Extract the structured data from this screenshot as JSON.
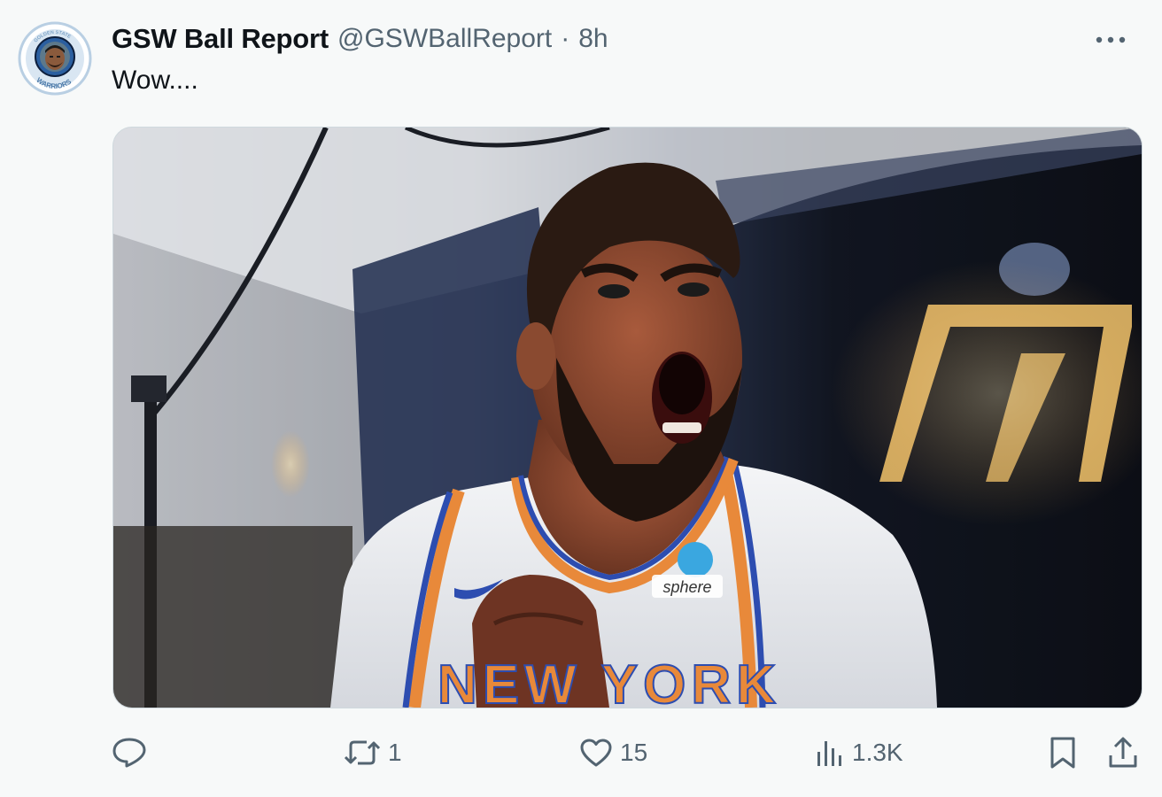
{
  "tweet": {
    "display_name": "GSW Ball Report",
    "handle": "@GSWBallReport",
    "separator": "·",
    "time": "8h",
    "text": "Wow....",
    "avatar": {
      "badge_text_top": "GOLDEN STATE",
      "badge_text_bottom": "WARRIORS"
    },
    "media": {
      "jersey_sponsor": "sphere",
      "jersey_text": "NEW YORK"
    }
  },
  "actions": {
    "reply_count": "",
    "retweet_count": "1",
    "like_count": "15",
    "views_count": "1.3K"
  },
  "colors": {
    "primary_text": "#0f1419",
    "secondary_text": "#536471",
    "background": "#f7f9f9",
    "border": "#cfd9de"
  },
  "icons": {
    "more": "more-horizontal-icon",
    "reply": "reply-icon",
    "retweet": "retweet-icon",
    "like": "heart-icon",
    "views": "views-icon",
    "bookmark": "bookmark-icon",
    "share": "share-icon"
  }
}
